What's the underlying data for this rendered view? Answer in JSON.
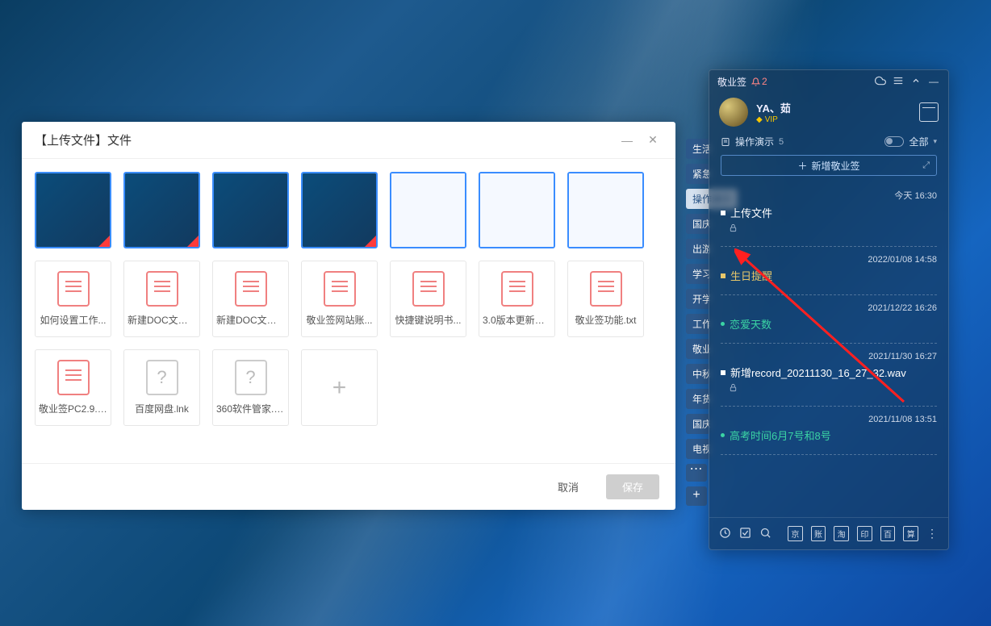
{
  "upload_dialog": {
    "title": "【上传文件】文件",
    "minimize_aria": "minimize",
    "close_aria": "close",
    "image_thumbs": [
      {
        "variant": "dark",
        "tri": true
      },
      {
        "variant": "dark",
        "tri": true
      },
      {
        "variant": "dark",
        "tri": false
      },
      {
        "variant": "dark",
        "tri": true
      },
      {
        "variant": "light",
        "tri": false
      },
      {
        "variant": "light",
        "tri": false
      },
      {
        "variant": "light",
        "tri": false
      }
    ],
    "doc_thumbs": [
      {
        "name": "如何设置工作..."
      },
      {
        "name": "新建DOC文档(..."
      },
      {
        "name": "新建DOC文档(..."
      },
      {
        "name": "敬业签网站账..."
      },
      {
        "name": "快捷键说明书..."
      },
      {
        "name": "3.0版本更新会..."
      },
      {
        "name": "敬业签功能.txt"
      },
      {
        "name": "敬业签PC2.9.0..."
      }
    ],
    "unknown_thumbs": [
      {
        "name": "百度网盘.lnk"
      },
      {
        "name": "360软件管家.lnk"
      }
    ],
    "add_label": "+",
    "cancel_label": "取消",
    "save_label": "保存"
  },
  "category_tabs": {
    "items": [
      "生活",
      "紧急",
      "操作演示",
      "国庆",
      "出游",
      "学习",
      "开学",
      "工作",
      "敬业",
      "中秋",
      "年货",
      "国庆",
      "电视"
    ],
    "more": "⋯",
    "add": "+"
  },
  "panel": {
    "app_name": "敬业签",
    "notification_count": "2",
    "header_icons": {
      "cloud": "cloud-icon",
      "menu": "menu-icon",
      "up": "collapse-up-icon",
      "close": "minimize-icon"
    },
    "user": {
      "name": "YA、茹",
      "vip_label": "VIP"
    },
    "section": {
      "title": "操作演示",
      "count": "5",
      "filter": "全部"
    },
    "add_note_label": "新增敬业签",
    "notes": [
      {
        "time": "今天 16:30",
        "title": "上传文件",
        "color": "white",
        "locked": true
      },
      {
        "time": "2022/01/08 14:58",
        "title": "生日提醒",
        "color": "gold",
        "locked": false
      },
      {
        "time": "2021/12/22 16:26",
        "title": "恋爱天数",
        "color": "teal",
        "locked": false
      },
      {
        "time": "2021/11/30 16:27",
        "title": "新增record_20211130_16_27_32.wav",
        "color": "white",
        "locked": true
      },
      {
        "time": "2021/11/08 13:51",
        "title": "高考时间6月7号和8号",
        "color": "teal",
        "locked": false
      }
    ],
    "footer_square_icons": [
      "京",
      "账",
      "淘",
      "印",
      "百",
      "算"
    ]
  }
}
